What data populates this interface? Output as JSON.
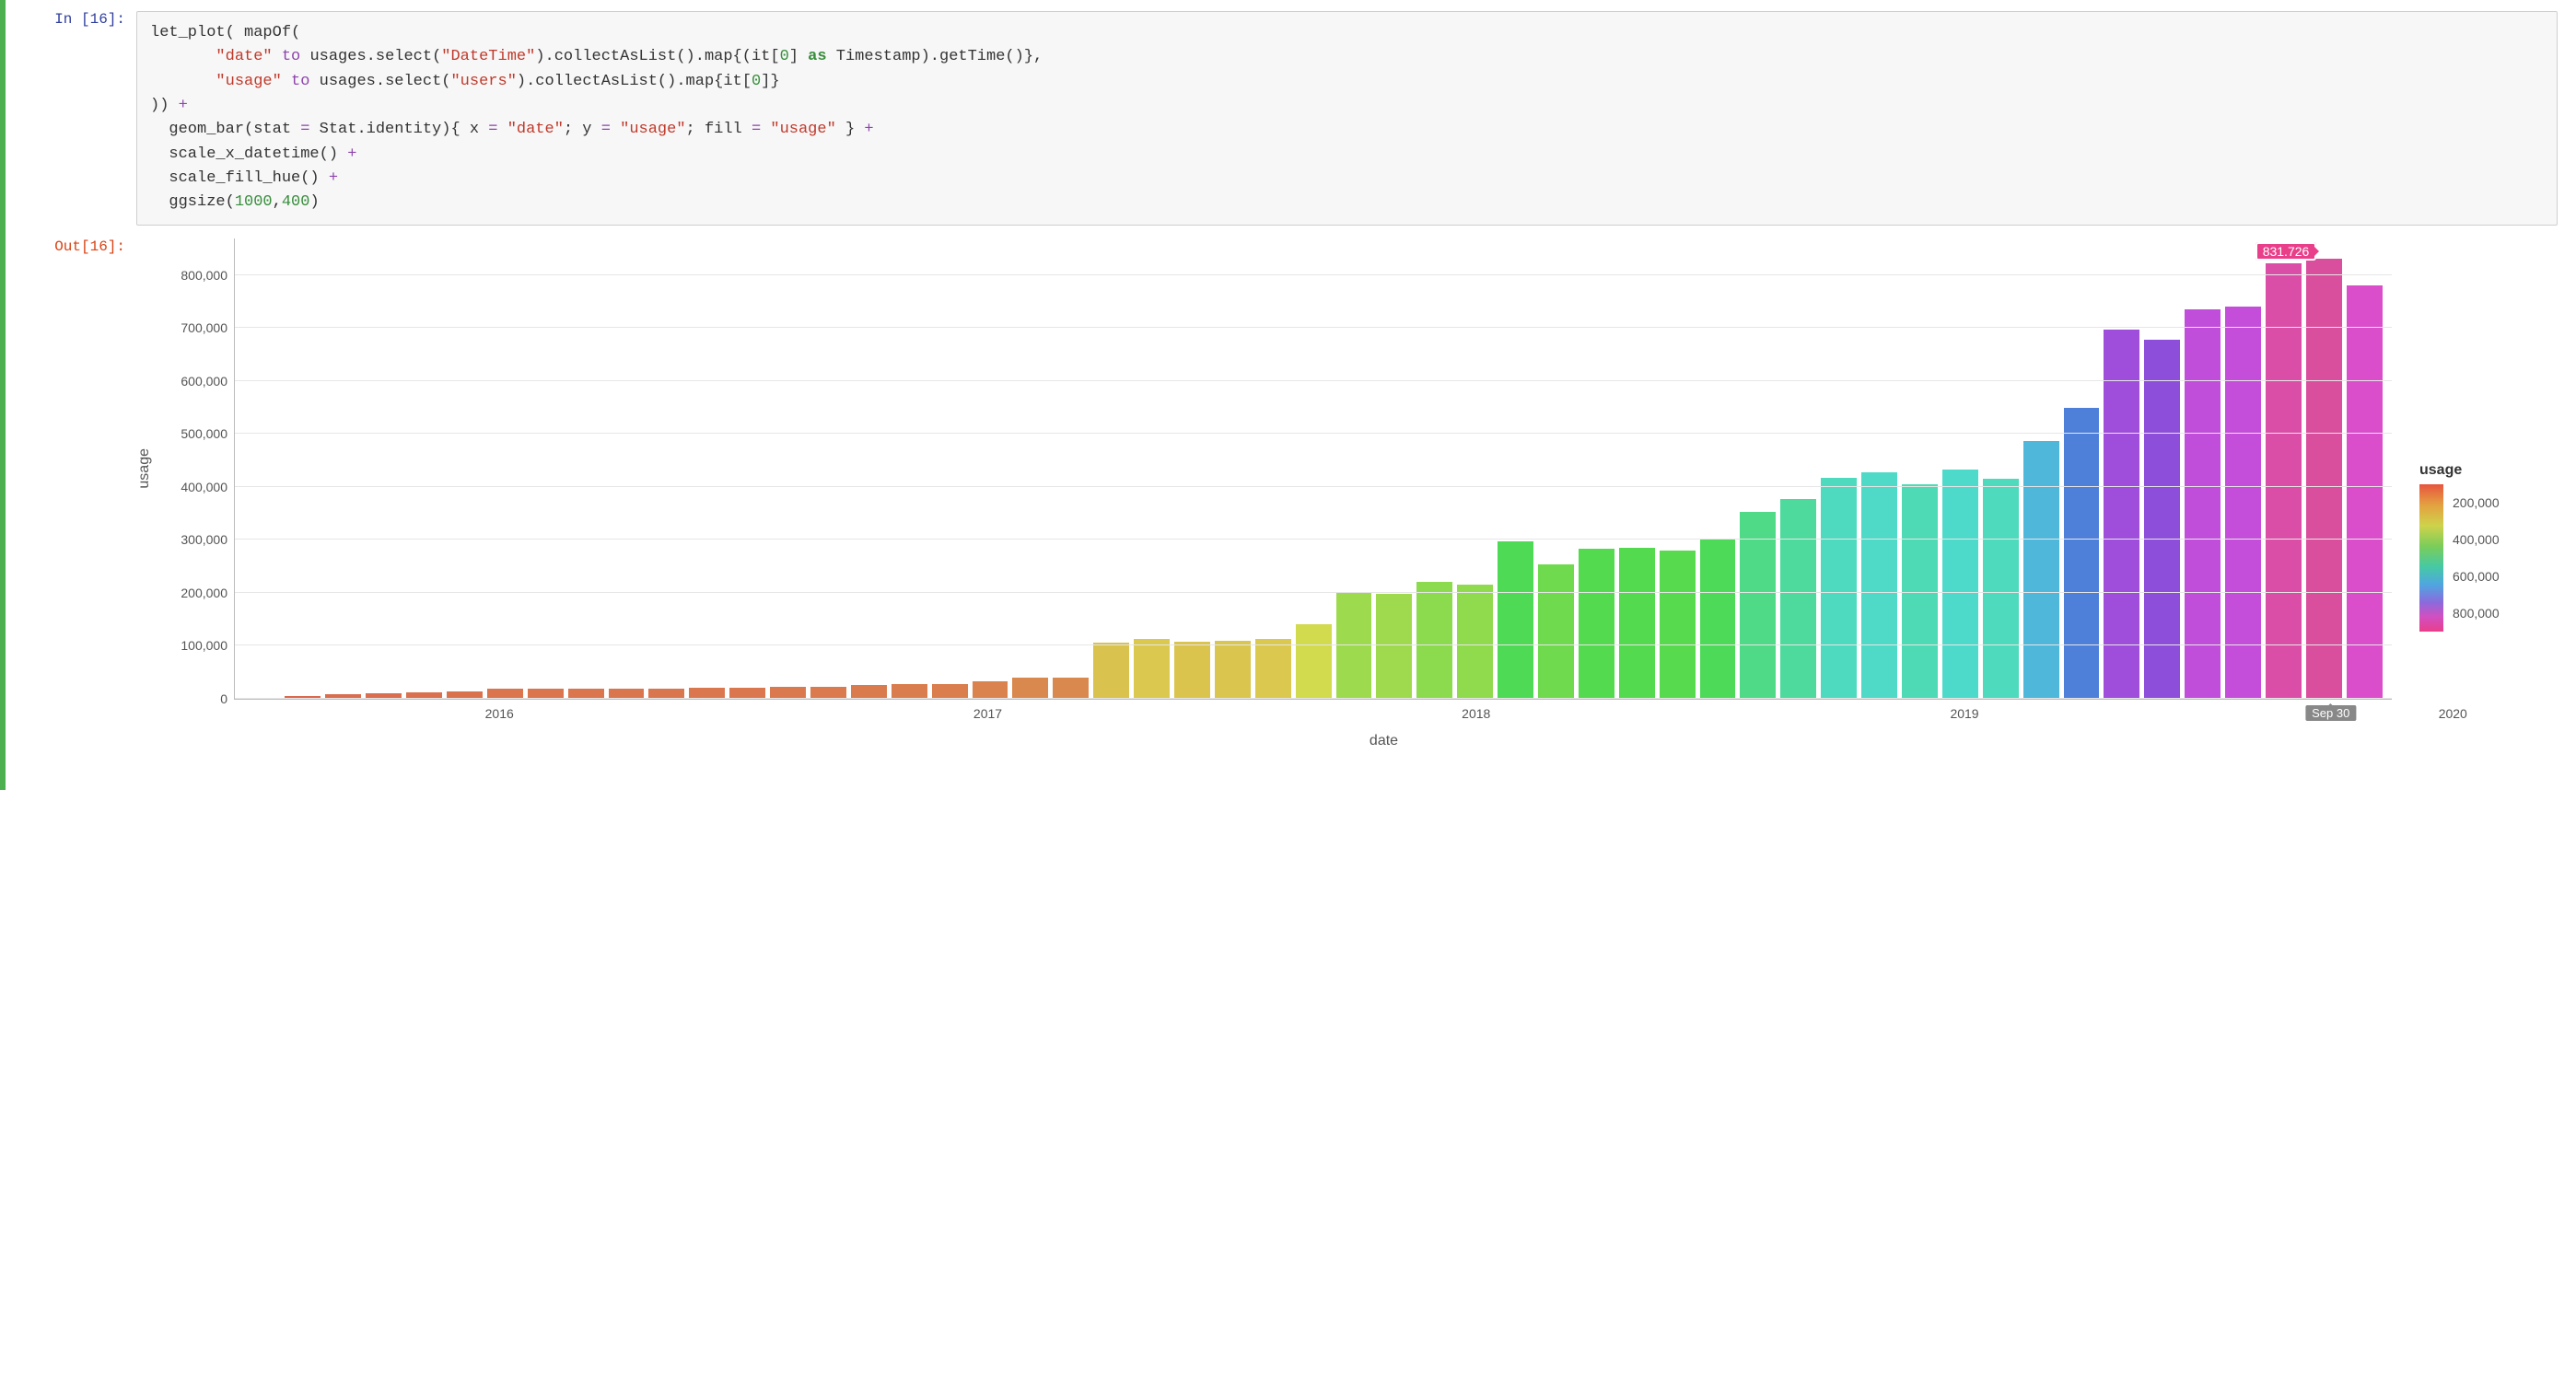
{
  "cell": {
    "in_prompt": "In [16]:",
    "out_prompt": "Out[16]:",
    "code_tokens": [
      [
        "id",
        "let_plot( mapOf(\n"
      ],
      [
        "id",
        "       "
      ],
      [
        "str",
        "\"date\""
      ],
      [
        "id",
        " "
      ],
      [
        "op",
        "to"
      ],
      [
        "id",
        " usages.select("
      ],
      [
        "str",
        "\"DateTime\""
      ],
      [
        "id",
        ").collectAsList().map{(it["
      ],
      [
        "num",
        "0"
      ],
      [
        "id",
        "] "
      ],
      [
        "kw",
        "as"
      ],
      [
        "id",
        " Timestamp).getTime()},\n"
      ],
      [
        "id",
        "       "
      ],
      [
        "str",
        "\"usage\""
      ],
      [
        "id",
        " "
      ],
      [
        "op",
        "to"
      ],
      [
        "id",
        " usages.select("
      ],
      [
        "str",
        "\"users\""
      ],
      [
        "id",
        ").collectAsList().map{it["
      ],
      [
        "num",
        "0"
      ],
      [
        "id",
        "]}\n"
      ],
      [
        "id",
        ")) "
      ],
      [
        "op",
        "+"
      ],
      [
        "id",
        "\n"
      ],
      [
        "id",
        "  geom_bar(stat "
      ],
      [
        "op",
        "="
      ],
      [
        "id",
        " Stat.identity){ x "
      ],
      [
        "op",
        "="
      ],
      [
        "id",
        " "
      ],
      [
        "str",
        "\"date\""
      ],
      [
        "id",
        "; y "
      ],
      [
        "op",
        "="
      ],
      [
        "id",
        " "
      ],
      [
        "str",
        "\"usage\""
      ],
      [
        "id",
        "; fill "
      ],
      [
        "op",
        "="
      ],
      [
        "id",
        " "
      ],
      [
        "str",
        "\"usage\""
      ],
      [
        "id",
        " } "
      ],
      [
        "op",
        "+"
      ],
      [
        "id",
        "\n"
      ],
      [
        "id",
        "  scale_x_datetime() "
      ],
      [
        "op",
        "+"
      ],
      [
        "id",
        "\n"
      ],
      [
        "id",
        "  scale_fill_hue() "
      ],
      [
        "op",
        "+"
      ],
      [
        "id",
        "\n"
      ],
      [
        "id",
        "  ggsize("
      ],
      [
        "num",
        "1000"
      ],
      [
        "id",
        ","
      ],
      [
        "num",
        "400"
      ],
      [
        "id",
        ")"
      ]
    ]
  },
  "chart_data": {
    "type": "bar",
    "xlabel": "date",
    "ylabel": "usage",
    "ylim": [
      0,
      870000
    ],
    "yticks": [
      0,
      100000,
      200000,
      300000,
      400000,
      500000,
      600000,
      700000,
      800000
    ],
    "ytick_labels": [
      "0",
      "100,000",
      "200,000",
      "300,000",
      "400,000",
      "500,000",
      "600,000",
      "700,000",
      "800,000"
    ],
    "xticks_years": [
      "2016",
      "2017",
      "2018",
      "2019",
      "2020"
    ],
    "data": [
      {
        "date": "2015-07",
        "value": 2000
      },
      {
        "date": "2015-08",
        "value": 4000
      },
      {
        "date": "2015-09",
        "value": 9000
      },
      {
        "date": "2015-10",
        "value": 10000
      },
      {
        "date": "2015-11",
        "value": 12000
      },
      {
        "date": "2015-12",
        "value": 14000
      },
      {
        "date": "2016-01",
        "value": 18000
      },
      {
        "date": "2016-02",
        "value": 18000
      },
      {
        "date": "2016-03",
        "value": 18000
      },
      {
        "date": "2016-04",
        "value": 19000
      },
      {
        "date": "2016-05",
        "value": 19000
      },
      {
        "date": "2016-06",
        "value": 20000
      },
      {
        "date": "2016-07",
        "value": 20000
      },
      {
        "date": "2016-08",
        "value": 22000
      },
      {
        "date": "2016-09",
        "value": 23000
      },
      {
        "date": "2016-10",
        "value": 25000
      },
      {
        "date": "2016-11",
        "value": 27000
      },
      {
        "date": "2016-12",
        "value": 28000
      },
      {
        "date": "2017-01",
        "value": 33000
      },
      {
        "date": "2017-02",
        "value": 40000
      },
      {
        "date": "2017-03",
        "value": 40000
      },
      {
        "date": "2017-04",
        "value": 105000
      },
      {
        "date": "2017-05",
        "value": 113000
      },
      {
        "date": "2017-06",
        "value": 107000
      },
      {
        "date": "2017-07",
        "value": 110000
      },
      {
        "date": "2017-08",
        "value": 113000
      },
      {
        "date": "2017-09",
        "value": 140000
      },
      {
        "date": "2017-10",
        "value": 200000
      },
      {
        "date": "2017-11",
        "value": 198000
      },
      {
        "date": "2017-12",
        "value": 220000
      },
      {
        "date": "2018-01",
        "value": 215000
      },
      {
        "date": "2018-02",
        "value": 298000
      },
      {
        "date": "2018-03",
        "value": 253000
      },
      {
        "date": "2018-04",
        "value": 283000
      },
      {
        "date": "2018-05",
        "value": 285000
      },
      {
        "date": "2018-06",
        "value": 280000
      },
      {
        "date": "2018-07",
        "value": 302000
      },
      {
        "date": "2018-08",
        "value": 353000
      },
      {
        "date": "2018-09",
        "value": 378000
      },
      {
        "date": "2018-10",
        "value": 418000
      },
      {
        "date": "2018-11",
        "value": 427000
      },
      {
        "date": "2018-12",
        "value": 405000
      },
      {
        "date": "2019-01",
        "value": 432000
      },
      {
        "date": "2019-02",
        "value": 415000
      },
      {
        "date": "2019-03",
        "value": 487000
      },
      {
        "date": "2019-04",
        "value": 550000
      },
      {
        "date": "2019-05",
        "value": 697000
      },
      {
        "date": "2019-06",
        "value": 678000
      },
      {
        "date": "2019-07",
        "value": 735000
      },
      {
        "date": "2019-08",
        "value": 740000
      },
      {
        "date": "2019-09",
        "value": 822000
      },
      {
        "date": "2019-10",
        "value": 831726
      },
      {
        "date": "2019-11",
        "value": 780000
      }
    ],
    "tooltip": {
      "value": "831.726",
      "date_label": "Sep 30",
      "bar_index": 51
    },
    "legend": {
      "title": "usage",
      "ticks": [
        "200,000",
        "400,000",
        "600,000",
        "800,000"
      ]
    }
  }
}
